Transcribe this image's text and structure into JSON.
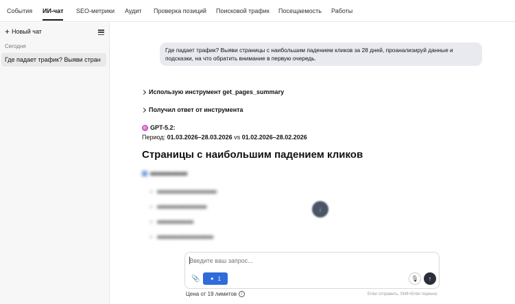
{
  "nav": {
    "tabs": [
      {
        "label": "События"
      },
      {
        "label": "ИИ-чат"
      },
      {
        "label": "SEO-метрики"
      },
      {
        "label": "Аудит"
      },
      {
        "label": "Проверка позиций"
      },
      {
        "label": "Поисковой трафик"
      },
      {
        "label": "Посещаемость"
      },
      {
        "label": "Работы"
      }
    ],
    "active_tab": "ИИ-чат"
  },
  "sidebar": {
    "new_chat_label": "Новый чат",
    "section_label": "Сегодня",
    "chats": [
      {
        "title": "Где падает трафик? Выяви стран"
      }
    ]
  },
  "conversation": {
    "user_message": "Где падает трафик? Выяви страницы с наибольшим падением кликов за 28 дней, проанализируй данные и подсказки, на что обратить внимание в первую очередь.",
    "tool_steps": [
      {
        "label": "Использую инструмент get_pages_summary"
      },
      {
        "label": "Получил ответ от инструмента"
      }
    ],
    "assistant": {
      "model_label": "GPT-5.2:",
      "period_prefix": "Период:",
      "period_current": "01.03.2026–28.03.2026",
      "period_vs": "vs",
      "period_previous": "01.02.2026–28.02.2026",
      "heading": "Страницы с наибольшим падением кликов"
    }
  },
  "composer": {
    "placeholder": "Введите ваш запрос...",
    "model_count": "1",
    "price_label": "Цена от 19 лимитов",
    "hint": "Enter отправить, Shift+Enter перенос"
  },
  "colors": {
    "accent": "#2f6bd9",
    "send_button": "#2b2f3a",
    "user_bubble": "#e8eaf0"
  }
}
